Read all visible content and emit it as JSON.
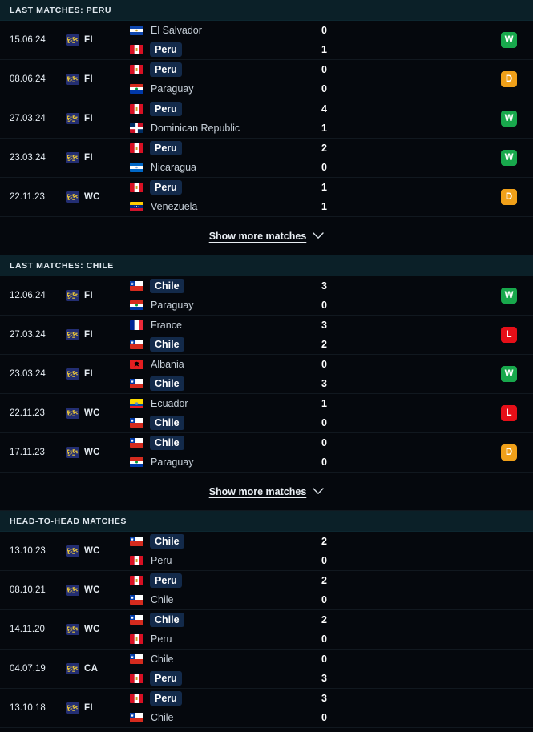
{
  "colors": {
    "background": "#05080d",
    "section_header_bg": "#0b2028",
    "highlight_chip": "#132a4a",
    "win": "#18a84c",
    "draw": "#f0a019",
    "loss": "#e60f18",
    "competition_badge": "#232e72"
  },
  "sections": [
    {
      "id": "last-matches-peru",
      "title": "LAST MATCHES: PERU",
      "show_more": {
        "label": "Show more matches",
        "icon": "chevron-down-icon"
      },
      "matches": [
        {
          "date": "15.06.24",
          "competition": "FI",
          "competition_icon": "world-map-icon",
          "home": {
            "name": "El Salvador",
            "flag": "el-salvador",
            "highlight": false
          },
          "away": {
            "name": "Peru",
            "flag": "peru",
            "highlight": true
          },
          "home_score": "0",
          "away_score": "1",
          "result": "W"
        },
        {
          "date": "08.06.24",
          "competition": "FI",
          "competition_icon": "world-map-icon",
          "home": {
            "name": "Peru",
            "flag": "peru",
            "highlight": true
          },
          "away": {
            "name": "Paraguay",
            "flag": "paraguay",
            "highlight": false
          },
          "home_score": "0",
          "away_score": "0",
          "result": "D"
        },
        {
          "date": "27.03.24",
          "competition": "FI",
          "competition_icon": "world-map-icon",
          "home": {
            "name": "Peru",
            "flag": "peru",
            "highlight": true
          },
          "away": {
            "name": "Dominican Republic",
            "flag": "dominican-republic",
            "highlight": false
          },
          "home_score": "4",
          "away_score": "1",
          "result": "W"
        },
        {
          "date": "23.03.24",
          "competition": "FI",
          "competition_icon": "world-map-icon",
          "home": {
            "name": "Peru",
            "flag": "peru",
            "highlight": true
          },
          "away": {
            "name": "Nicaragua",
            "flag": "nicaragua",
            "highlight": false
          },
          "home_score": "2",
          "away_score": "0",
          "result": "W"
        },
        {
          "date": "22.11.23",
          "competition": "WC",
          "competition_icon": "world-map-icon",
          "home": {
            "name": "Peru",
            "flag": "peru",
            "highlight": true
          },
          "away": {
            "name": "Venezuela",
            "flag": "venezuela",
            "highlight": false
          },
          "home_score": "1",
          "away_score": "1",
          "result": "D"
        }
      ]
    },
    {
      "id": "last-matches-chile",
      "title": "LAST MATCHES: CHILE",
      "show_more": {
        "label": "Show more matches",
        "icon": "chevron-down-icon"
      },
      "matches": [
        {
          "date": "12.06.24",
          "competition": "FI",
          "competition_icon": "world-map-icon",
          "home": {
            "name": "Chile",
            "flag": "chile",
            "highlight": true
          },
          "away": {
            "name": "Paraguay",
            "flag": "paraguay",
            "highlight": false
          },
          "home_score": "3",
          "away_score": "0",
          "result": "W"
        },
        {
          "date": "27.03.24",
          "competition": "FI",
          "competition_icon": "world-map-icon",
          "home": {
            "name": "France",
            "flag": "france",
            "highlight": false
          },
          "away": {
            "name": "Chile",
            "flag": "chile",
            "highlight": true
          },
          "home_score": "3",
          "away_score": "2",
          "result": "L"
        },
        {
          "date": "23.03.24",
          "competition": "FI",
          "competition_icon": "world-map-icon",
          "home": {
            "name": "Albania",
            "flag": "albania",
            "highlight": false
          },
          "away": {
            "name": "Chile",
            "flag": "chile",
            "highlight": true
          },
          "home_score": "0",
          "away_score": "3",
          "result": "W"
        },
        {
          "date": "22.11.23",
          "competition": "WC",
          "competition_icon": "world-map-icon",
          "home": {
            "name": "Ecuador",
            "flag": "ecuador",
            "highlight": false
          },
          "away": {
            "name": "Chile",
            "flag": "chile",
            "highlight": true
          },
          "home_score": "1",
          "away_score": "0",
          "result": "L"
        },
        {
          "date": "17.11.23",
          "competition": "WC",
          "competition_icon": "world-map-icon",
          "home": {
            "name": "Chile",
            "flag": "chile",
            "highlight": true
          },
          "away": {
            "name": "Paraguay",
            "flag": "paraguay",
            "highlight": false
          },
          "home_score": "0",
          "away_score": "0",
          "result": "D"
        }
      ]
    },
    {
      "id": "head-to-head-matches",
      "title": "HEAD-TO-HEAD MATCHES",
      "show_more": null,
      "matches": [
        {
          "date": "13.10.23",
          "competition": "WC",
          "competition_icon": "world-map-icon",
          "home": {
            "name": "Chile",
            "flag": "chile",
            "highlight": true
          },
          "away": {
            "name": "Peru",
            "flag": "peru",
            "highlight": false
          },
          "home_score": "2",
          "away_score": "0",
          "result": ""
        },
        {
          "date": "08.10.21",
          "competition": "WC",
          "competition_icon": "world-map-icon",
          "home": {
            "name": "Peru",
            "flag": "peru",
            "highlight": true
          },
          "away": {
            "name": "Chile",
            "flag": "chile",
            "highlight": false
          },
          "home_score": "2",
          "away_score": "0",
          "result": ""
        },
        {
          "date": "14.11.20",
          "competition": "WC",
          "competition_icon": "world-map-icon",
          "home": {
            "name": "Chile",
            "flag": "chile",
            "highlight": true
          },
          "away": {
            "name": "Peru",
            "flag": "peru",
            "highlight": false
          },
          "home_score": "2",
          "away_score": "0",
          "result": ""
        },
        {
          "date": "04.07.19",
          "competition": "CA",
          "competition_icon": "world-map-icon",
          "home": {
            "name": "Chile",
            "flag": "chile",
            "highlight": false
          },
          "away": {
            "name": "Peru",
            "flag": "peru",
            "highlight": true
          },
          "home_score": "0",
          "away_score": "3",
          "result": ""
        },
        {
          "date": "13.10.18",
          "competition": "FI",
          "competition_icon": "world-map-icon",
          "home": {
            "name": "Peru",
            "flag": "peru",
            "highlight": true
          },
          "away": {
            "name": "Chile",
            "flag": "chile",
            "highlight": false
          },
          "home_score": "3",
          "away_score": "0",
          "result": ""
        }
      ]
    }
  ]
}
